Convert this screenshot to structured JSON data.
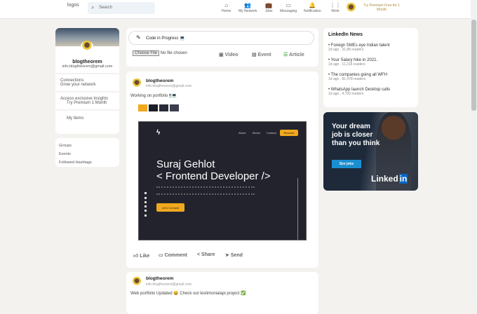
{
  "header": {
    "logo_alt": "logos",
    "search_placeholder": "Search",
    "nav": [
      {
        "label": "Home",
        "icon": "home-icon"
      },
      {
        "label": "My Network",
        "icon": "network-icon"
      },
      {
        "label": "Jobs",
        "icon": "briefcase-icon"
      },
      {
        "label": "Messaging",
        "icon": "message-icon"
      },
      {
        "label": "Notification",
        "icon": "bell-icon"
      },
      {
        "label": "Work",
        "icon": "grid-icon"
      }
    ],
    "premium": "Try Premium Free for 1 Month"
  },
  "sidebar": {
    "name": "blogtheorem",
    "email": "info.blogtheorem@gmail.com",
    "connections": "Connections",
    "grow": "Grow your network",
    "insights": "Access exclusive Insights",
    "premium": "Try Premium 1 Month",
    "my_items": "My Items",
    "links": [
      "Groups",
      "Events",
      "Followed Hashtags"
    ]
  },
  "share": {
    "input_value": "Code in Progress 💻",
    "choose_file": "Choose File",
    "no_file": "No file chosen",
    "video": "Video",
    "event": "Event",
    "article": "Article"
  },
  "posts": [
    {
      "name": "blogtheorem",
      "email": "info.blogtheorem@gmail.com",
      "text": "Working on portfolio 🖱💻",
      "swatches": [
        "#f2a81d",
        "#1c1d26",
        "#2a2b38",
        "#3d3e4e"
      ],
      "image": {
        "nav": [
          "About",
          "Works",
          "Contact",
          "Resume"
        ],
        "title1": "Suraj Gehlot",
        "title2": "< Frontend Developer />",
        "cta": "Let's Connect"
      },
      "actions": [
        "Like",
        "Comment",
        "Share",
        "Send"
      ]
    },
    {
      "name": "blogtheorem",
      "email": "info.blogtheorem@gmail.com",
      "text": "Web portfolio Updated 😀 Check out testimonialapi project ✅"
    }
  ],
  "news": {
    "title": "LinkedIn News",
    "items": [
      {
        "title": "Foreign SMEs eye Indian talent",
        "meta": "2d ago . 31,88 readers"
      },
      {
        "title": "Your Salary hike in 2021.",
        "meta": "1d ago . 11,216 readers"
      },
      {
        "title": "The companies going all WFH",
        "meta": "1d ago . 81,478 readers"
      },
      {
        "title": "WhatsApp launch Desktop calls",
        "meta": "1d ago . 4,700 readers"
      }
    ]
  },
  "ad": {
    "text": "Your dream job is closer than you think",
    "button": "See jobs",
    "brand1": "Linked",
    "brand2": "in"
  },
  "colors": {
    "accent": "#0a66c2",
    "background": "#f3f2ef",
    "portfolio_yellow": "#f2a81d"
  }
}
